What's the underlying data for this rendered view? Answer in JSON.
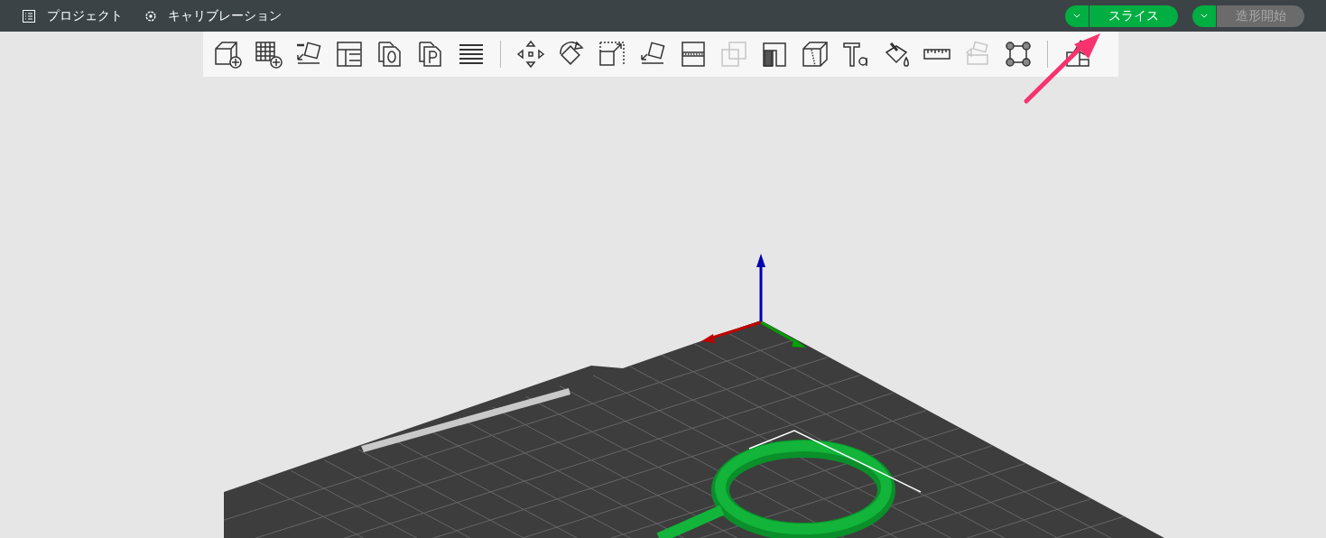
{
  "top_bar": {
    "menus": [
      {
        "label": "プロジェクト",
        "kind": "project"
      },
      {
        "label": "キャリブレーション",
        "kind": "calibration"
      }
    ],
    "actions": [
      {
        "label": "スライス",
        "disabled": false
      },
      {
        "label": "造形開始",
        "disabled": true
      }
    ]
  },
  "toolbar": {
    "groups": [
      [
        {
          "kind": "add-cube",
          "disabled": false
        },
        {
          "kind": "add-plate",
          "disabled": false
        },
        {
          "kind": "auto-orient",
          "disabled": false
        },
        {
          "kind": "arrange",
          "disabled": false
        },
        {
          "kind": "copy-o",
          "disabled": false
        },
        {
          "kind": "copy-p",
          "disabled": false
        },
        {
          "kind": "layers",
          "disabled": false
        }
      ],
      [
        {
          "kind": "move",
          "disabled": false
        },
        {
          "kind": "rotate",
          "disabled": false
        },
        {
          "kind": "scale",
          "disabled": false
        },
        {
          "kind": "lay-face",
          "disabled": false
        },
        {
          "kind": "cut",
          "disabled": false
        },
        {
          "kind": "boolean",
          "disabled": true
        },
        {
          "kind": "support",
          "disabled": false
        },
        {
          "kind": "seam",
          "disabled": false
        },
        {
          "kind": "text",
          "disabled": false
        },
        {
          "kind": "paint",
          "disabled": false
        },
        {
          "kind": "measure",
          "disabled": false
        },
        {
          "kind": "assembly",
          "disabled": true
        },
        {
          "kind": "brim",
          "disabled": false
        }
      ],
      [
        {
          "kind": "split",
          "disabled": false
        }
      ]
    ]
  }
}
